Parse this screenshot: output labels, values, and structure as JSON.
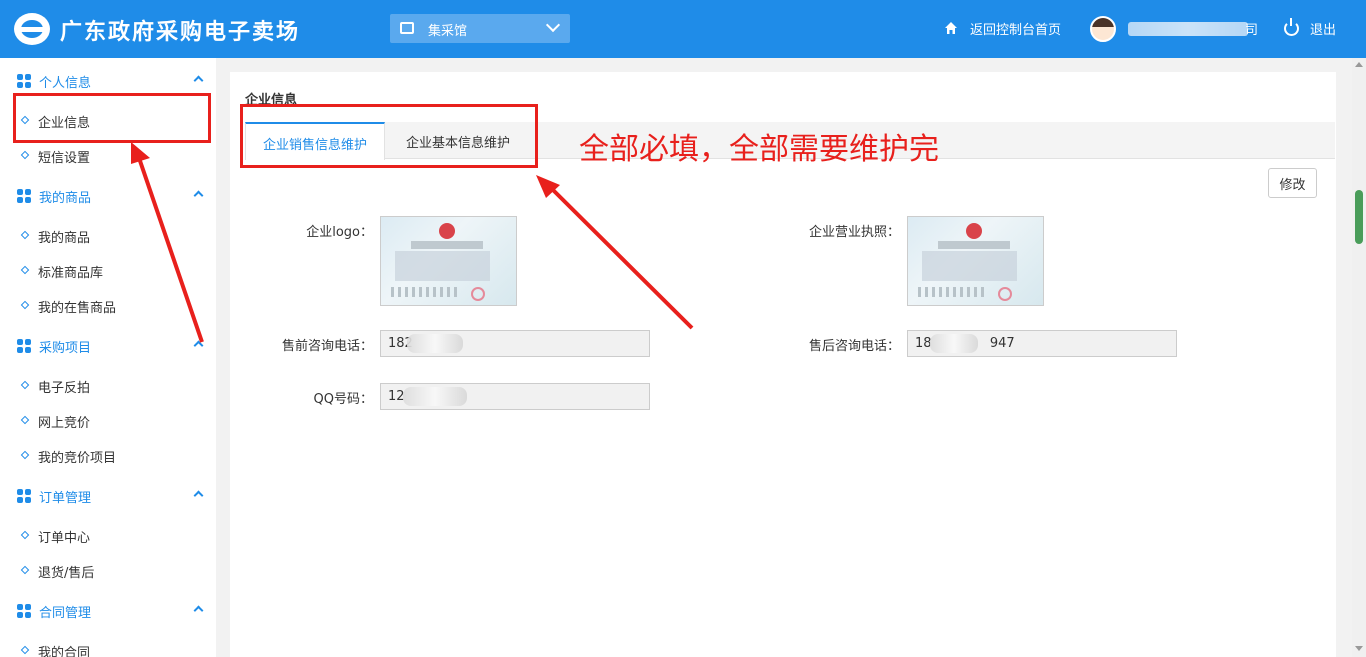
{
  "header": {
    "app_title": "广东政府采购电子卖场",
    "venue_select": "集采馆",
    "home_link": "返回控制台首页",
    "username_tail": "司",
    "logout": "退出"
  },
  "sidebar": {
    "sections": [
      {
        "label": "个人信息",
        "items": [
          "企业信息",
          "短信设置"
        ]
      },
      {
        "label": "我的商品",
        "items": [
          "我的商品",
          "标准商品库",
          "我的在售商品"
        ]
      },
      {
        "label": "采购项目",
        "items": [
          "电子反拍",
          "网上竞价",
          "我的竞价项目"
        ]
      },
      {
        "label": "订单管理",
        "items": [
          "订单中心",
          "退货/售后"
        ]
      },
      {
        "label": "合同管理",
        "items": [
          "我的合同"
        ]
      }
    ]
  },
  "main": {
    "page_title": "企业信息",
    "tabs": [
      {
        "label": "企业销售信息维护",
        "active": true
      },
      {
        "label": "企业基本信息维护",
        "active": false
      }
    ],
    "edit_button": "修改",
    "fields": {
      "logo_label": "企业logo：",
      "license_label": "企业营业执照：",
      "presale_phone_label": "售前咨询电话：",
      "presale_phone_value": "182",
      "aftersale_phone_label": "售后咨询电话：",
      "aftersale_phone_value_head": "18",
      "aftersale_phone_value_tail": "947",
      "qq_label": "QQ号码：",
      "qq_value": "12"
    }
  },
  "annotation": {
    "text": "全部必填，全部需要维护完",
    "color": "#e8201c"
  },
  "colors": {
    "brand": "#1f8ce8",
    "header_bg": "#1f8ce8"
  }
}
